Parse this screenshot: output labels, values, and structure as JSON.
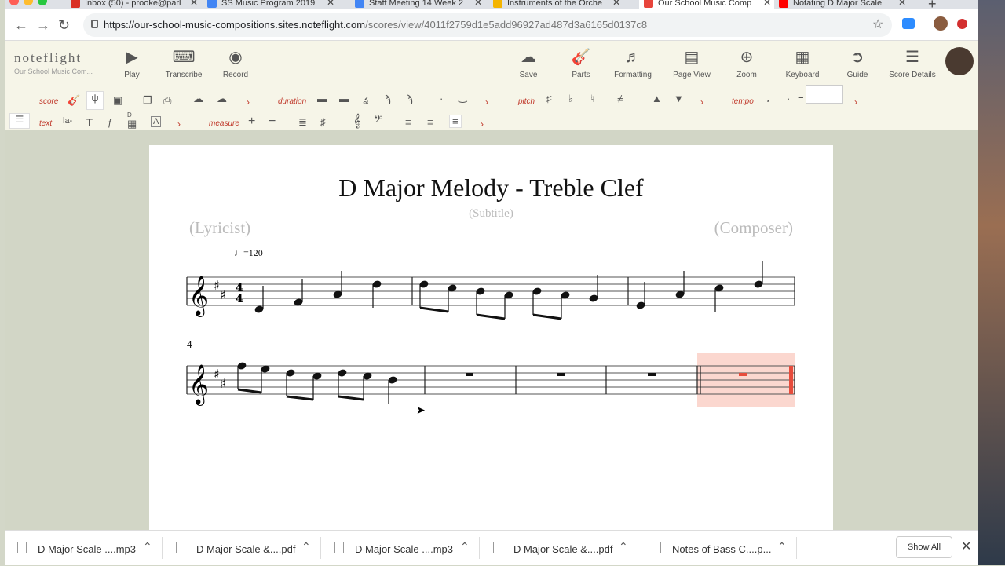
{
  "browser": {
    "tabs": [
      {
        "title": "Inbox (50) - prooke@parl",
        "color": "#d93025"
      },
      {
        "title": "SS Music Program 2019",
        "color": "#4285f4"
      },
      {
        "title": "Staff Meeting 14 Week 2",
        "color": "#4285f4"
      },
      {
        "title": "Instruments of the Orche",
        "color": "#f4b400"
      },
      {
        "title": "Our School Music Comp",
        "color": "#e8453c",
        "active": true
      },
      {
        "title": "Notating D Major Scale",
        "color": "#ff0000"
      }
    ],
    "url_main": "https://our-school-music-compositions.sites.noteflight.com",
    "url_path": "/scores/view/4011f2759d1e5add96927ad487d3a6165d0137c8"
  },
  "toolbar": {
    "logo_word": "noteflight",
    "logo_sub": "Our School Music Com...",
    "left": [
      {
        "label": "Play",
        "icon": "play-icon",
        "glyph": "▶"
      },
      {
        "label": "Transcribe",
        "icon": "transcribe-icon",
        "glyph": "⌨"
      },
      {
        "label": "Record",
        "icon": "record-icon",
        "glyph": "◉"
      }
    ],
    "right": [
      {
        "label": "Save",
        "icon": "cloud-save-icon",
        "glyph": "☁"
      },
      {
        "label": "Parts",
        "icon": "guitar-icon",
        "glyph": "🎸"
      },
      {
        "label": "Formatting",
        "icon": "formatting-icon",
        "glyph": "♬"
      },
      {
        "label": "Page View",
        "icon": "page-view-icon",
        "glyph": "▤"
      },
      {
        "label": "Zoom",
        "icon": "zoom-icon",
        "glyph": "⊕"
      },
      {
        "label": "Keyboard",
        "icon": "keyboard-icon",
        "glyph": "▦"
      },
      {
        "label": "Guide",
        "icon": "guide-icon",
        "glyph": "➲"
      },
      {
        "label": "Score Details",
        "icon": "score-details-icon",
        "glyph": "☰"
      }
    ]
  },
  "palette": {
    "score": "score",
    "duration": "duration",
    "pitch": "pitch",
    "tempo": "tempo",
    "text": "text",
    "lyric": "la-",
    "measure": "measure",
    "chord": "D",
    "tempo_eq": "="
  },
  "score": {
    "title": "D Major Melody - Treble Clef",
    "subtitle": "(Subtitle)",
    "lyricist": "(Lyricist)",
    "composer": "(Composer)",
    "tempo": "=120",
    "measure_number": "4",
    "time_signature": [
      "4",
      "4"
    ]
  },
  "downloads": {
    "items": [
      {
        "name": "D Major Scale ....mp3"
      },
      {
        "name": "D Major Scale &....pdf"
      },
      {
        "name": "D Major Scale ....mp3"
      },
      {
        "name": "D Major Scale &....pdf"
      },
      {
        "name": "Notes of Bass C....p..."
      }
    ],
    "show_all": "Show All"
  },
  "colors": {
    "accent": "#c0392b",
    "toolbar_bg": "#f6f5e8",
    "highlight": "#fbd7cf"
  }
}
